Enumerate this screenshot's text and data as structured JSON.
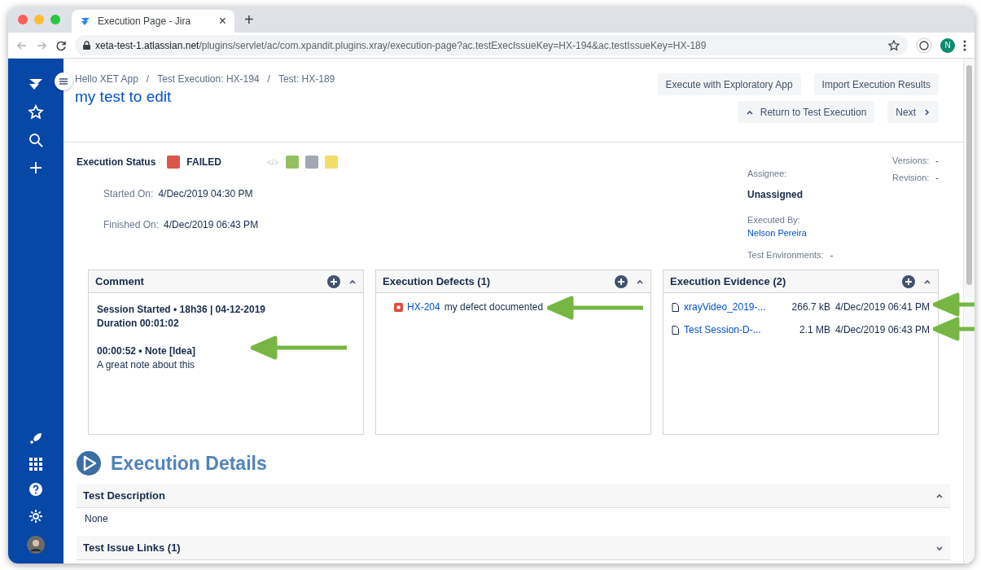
{
  "browser": {
    "tab_title": "Execution Page - Jira",
    "tab_close": "×",
    "new_tab": "+",
    "url_host": "xeta-test-1.atlassian.net",
    "url_path": "/plugins/servlet/ac/com.xpandit.plugins.xray/execution-page?ac.testExecIssueKey=HX-194&ac.testIssueKey=HX-189",
    "profile_initial": "N"
  },
  "breadcrumbs": [
    "Hello XET App",
    "Test Execution: HX-194",
    "Test: HX-189"
  ],
  "breadcrumb_separator": "/",
  "title": "my test to edit",
  "actions": [
    {
      "label": "Execute with Exploratory App",
      "kind": "plain"
    },
    {
      "label": "Import Execution Results",
      "kind": "plain"
    },
    {
      "label": "Return to Test Execution",
      "kind": "up"
    },
    {
      "label": "Next",
      "kind": "next"
    }
  ],
  "execution_status": {
    "label": "Execution Status",
    "value": "FAILED",
    "color": "#d9574b",
    "code_toggle": "</>",
    "quick_statuses": [
      {
        "color": "#94c160"
      },
      {
        "color": "#a2a7b2"
      },
      {
        "color": "#f0de6a"
      }
    ]
  },
  "dates": [
    {
      "label": "Started On:",
      "value": "4/Dec/2019 04:30 PM"
    },
    {
      "label": "Finished On:",
      "value": "4/Dec/2019 06:43 PM"
    }
  ],
  "people": {
    "assignee_label": "Assignee:",
    "assignee": "Unassigned",
    "executed_by_label": "Executed By:",
    "executed_by": "Nelson Pereira",
    "environments_label": "Test Environments:",
    "environments": "-"
  },
  "versions": [
    {
      "label": "Versions:",
      "value": "-"
    },
    {
      "label": "Revision:",
      "value": "-"
    }
  ],
  "comment": {
    "title": "Comment",
    "lines": [
      {
        "text": "Session Started • 18h36 | 04-12-2019",
        "kind": "bold"
      },
      {
        "text": "Duration 00:01:02",
        "kind": "bold"
      },
      {
        "kind": "gap"
      },
      {
        "text": "00:00:52 • Note [Idea]",
        "kind": "bold"
      },
      {
        "text": "A great note about this",
        "kind": "plain"
      }
    ]
  },
  "defects": {
    "title": "Execution Defects (1)",
    "items": [
      {
        "key": "HX-204",
        "summary": "my defect documented"
      }
    ]
  },
  "evidence": {
    "title": "Execution Evidence (2)",
    "items": [
      {
        "name": "xrayVideo_2019-...",
        "size": "266.7 kB",
        "date": "4/Dec/2019 06:41 PM"
      },
      {
        "name": "Test Session-D-...",
        "size": "2.1 MB",
        "date": "4/Dec/2019 06:43 PM"
      }
    ]
  },
  "details_title": "Execution Details",
  "sections": [
    {
      "title": "Test Description",
      "expanded": true,
      "body": "None"
    },
    {
      "title": "Test Issue Links (1)",
      "expanded": false
    }
  ]
}
